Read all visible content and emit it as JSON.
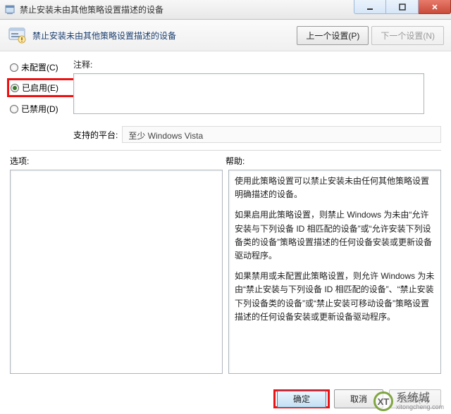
{
  "window": {
    "title": "禁止安装未由其他策略设置描述的设备"
  },
  "header": {
    "title": "禁止安装未由其他策略设置描述的设备",
    "prev": "上一个设置(P)",
    "next": "下一个设置(N)"
  },
  "radios": {
    "not_configured": "未配置(C)",
    "enabled": "已启用(E)",
    "disabled": "已禁用(D)"
  },
  "labels": {
    "comment": "注释:",
    "platforms": "支持的平台:",
    "options": "选项:",
    "help": "帮助:"
  },
  "platforms": {
    "value": "至少 Windows Vista"
  },
  "help": {
    "p1": "使用此策略设置可以禁止安装未由任何其他策略设置明确描述的设备。",
    "p2": "如果启用此策略设置，则禁止 Windows 为未由“允许安装与下列设备 ID 相匹配的设备”或“允许安装下列设备类的设备”策略设置描述的任何设备安装或更新设备驱动程序。",
    "p3": "如果禁用或未配置此策略设置，则允许 Windows 为未由“禁止安装与下列设备 ID 相匹配的设备”、“禁止安装下列设备类的设备”或“禁止安装可移动设备”策略设置描述的任何设备安装或更新设备驱动程序。"
  },
  "footer": {
    "ok": "确定",
    "cancel": "取消",
    "apply": "应用(A)"
  },
  "watermark": {
    "brand": "系统城",
    "domain": "xitongcheng.com"
  }
}
